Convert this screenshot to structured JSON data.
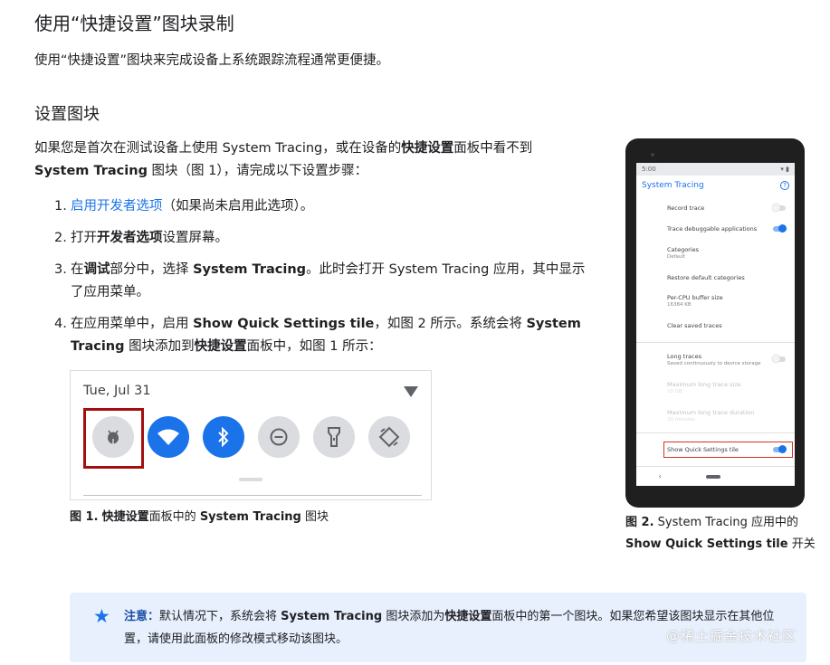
{
  "page": {
    "title": "使用“快捷设置”图块录制",
    "intro": "使用“快捷设置”图块来完成设备上系统跟踪流程通常更便捷。",
    "section_title": "设置图块"
  },
  "para": {
    "t1": "如果您是首次在测试设备上使用 System Tracing，或在设备的",
    "b1": "快捷设置",
    "t2": "面板中看不到 ",
    "b2": "System Tracing",
    "t3": " 图块（图 1），请完成以下设置步骤："
  },
  "steps": [
    {
      "num": "1.",
      "link": "启用开发者选项",
      "t1": "（如果尚未启用此选项）。"
    },
    {
      "num": "2.",
      "t1": "打开",
      "b1": "开发者选项",
      "t2": "设置屏幕。"
    },
    {
      "num": "3.",
      "t1": "在",
      "b1": "调试",
      "t2": "部分中，选择 ",
      "b2": "System Tracing",
      "t3": "。此时会打开 System Tracing 应用，其中显示了应用菜单。"
    },
    {
      "num": "4.",
      "t1": "在应用菜单中，启用 ",
      "b1": "Show Quick Settings tile",
      "t2": "，如图 2 所示。系统会将 ",
      "b2": "System Tracing",
      "t3": " 图块添加到",
      "b3": "快捷设置",
      "t4": "面板中，如图 1 所示："
    }
  ],
  "qs_panel": {
    "date": "Tue, Jul 31",
    "tiles": [
      "bug-icon",
      "wifi-icon",
      "bluetooth-icon",
      "dnd-icon",
      "flashlight-icon",
      "rotate-icon"
    ]
  },
  "figure1": {
    "num": "图 1.",
    "b1": "快捷设置",
    "t1": "面板中的 ",
    "b2": "System Tracing",
    "t2": " 图块"
  },
  "phone": {
    "time": "5:00",
    "app_title": "System Tracing",
    "prefs": {
      "record_trace": "Record trace",
      "trace_debuggable": "Trace debuggable applications",
      "categories": "Categories",
      "categories_sub": "Default",
      "restore": "Restore default categories",
      "buffer": "Per-CPU buffer size",
      "buffer_sub": "16384 KB",
      "clear": "Clear saved traces",
      "long_traces": "Long traces",
      "long_traces_sub": "Saved continuously to device storage",
      "max_size": "Maximum long trace size",
      "max_size_sub": "10 GB",
      "max_duration": "Maximum long trace duration",
      "max_duration_sub": "30 minutes",
      "show_qs": "Show Quick Settings tile"
    }
  },
  "figure2": {
    "num": "图 2.",
    "t1": " System Tracing 应用中的",
    "b1": "Show Quick Settings tile",
    "t2": " 开关"
  },
  "note": {
    "label": "注意：",
    "t1": "默认情况下，系统会将 ",
    "b1": "System Tracing",
    "t2": " 图块添加为",
    "b2": "快捷设置",
    "t3": "面板中的第一个图块。如果您希望该图块显示在其他位置，请使用此面板的修改模式移动该图块。"
  },
  "watermark": "@稀土掘金技术社区",
  "colors": {
    "accent": "#1a73e8",
    "highlight": "#a50e0e",
    "note_bg": "#e8f0fe"
  }
}
